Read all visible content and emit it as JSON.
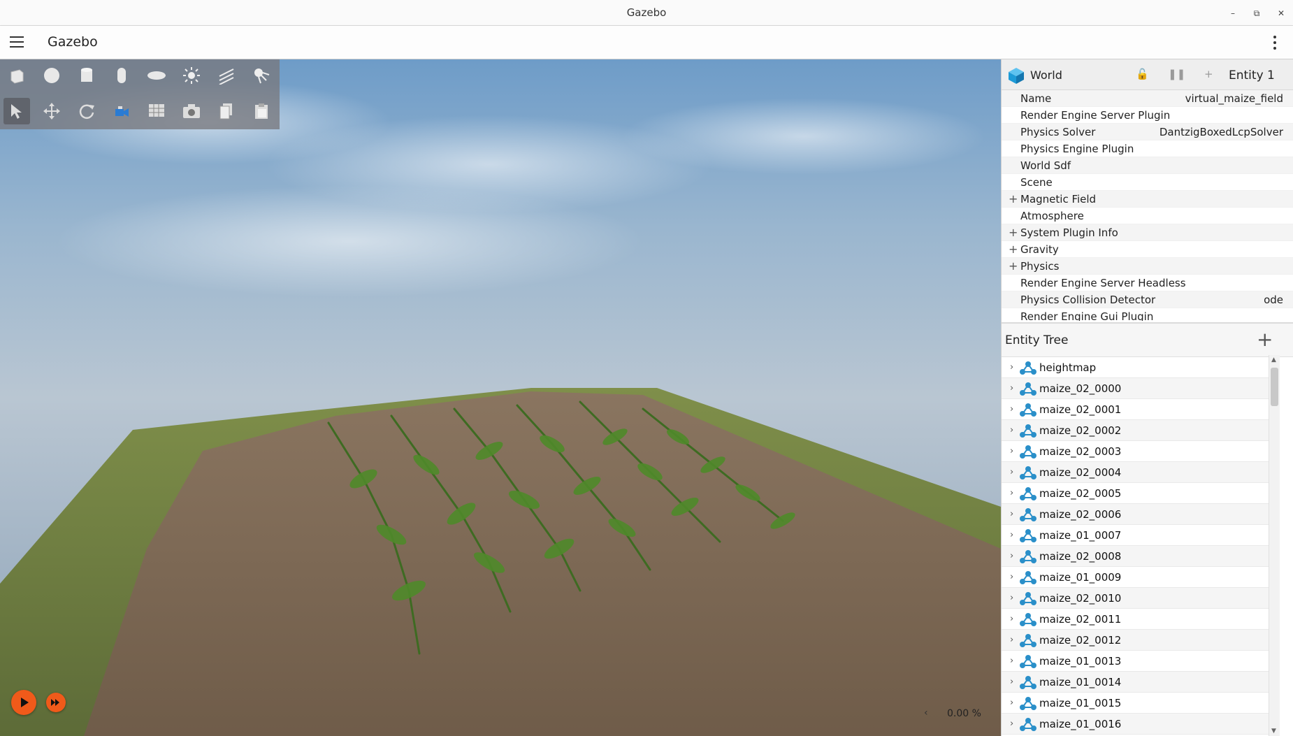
{
  "window": {
    "title": "Gazebo"
  },
  "app": {
    "title": "Gazebo"
  },
  "toolbar": {
    "shapes": [
      "box-icon",
      "sphere-icon",
      "cylinder-icon",
      "capsule-icon",
      "ellipsoid-icon",
      "point-light-icon",
      "directional-light-icon",
      "spot-light-icon"
    ],
    "tools": [
      "select-icon",
      "translate-icon",
      "rotate-icon",
      "view-angle-icon",
      "grid-icon",
      "screenshot-icon",
      "copy-icon",
      "paste-icon"
    ]
  },
  "playback": {
    "rtf": "0.00 %"
  },
  "component_inspector": {
    "title": "World",
    "entity": "Entity 1",
    "properties": [
      {
        "name": "Name",
        "value": "virtual_maize_field",
        "expandable": false
      },
      {
        "name": "Render Engine Server Plugin",
        "value": "",
        "expandable": false
      },
      {
        "name": "Physics Solver",
        "value": "DantzigBoxedLcpSolver",
        "expandable": false
      },
      {
        "name": "Physics Engine Plugin",
        "value": "",
        "expandable": false
      },
      {
        "name": "World Sdf",
        "value": "",
        "expandable": false
      },
      {
        "name": "Scene",
        "value": "",
        "expandable": false
      },
      {
        "name": "Magnetic Field",
        "value": "",
        "expandable": true
      },
      {
        "name": "Atmosphere",
        "value": "",
        "expandable": false
      },
      {
        "name": "System Plugin Info",
        "value": "",
        "expandable": true
      },
      {
        "name": "Gravity",
        "value": "",
        "expandable": true
      },
      {
        "name": "Physics",
        "value": "",
        "expandable": true
      },
      {
        "name": "Render Engine Server Headless",
        "value": "",
        "expandable": false
      },
      {
        "name": "Physics Collision Detector",
        "value": "ode",
        "expandable": false
      },
      {
        "name": "Render Engine Gui Plugin",
        "value": "",
        "expandable": false
      }
    ]
  },
  "entity_tree": {
    "title": "Entity Tree",
    "items": [
      "heightmap",
      "maize_02_0000",
      "maize_02_0001",
      "maize_02_0002",
      "maize_02_0003",
      "maize_02_0004",
      "maize_02_0005",
      "maize_02_0006",
      "maize_01_0007",
      "maize_02_0008",
      "maize_01_0009",
      "maize_02_0010",
      "maize_02_0011",
      "maize_02_0012",
      "maize_01_0013",
      "maize_01_0014",
      "maize_01_0015",
      "maize_01_0016"
    ]
  },
  "colors": {
    "accent_play": "#f05a1a",
    "world_icon": "#1e9bd7",
    "model_icon": "#2a8fc9"
  }
}
